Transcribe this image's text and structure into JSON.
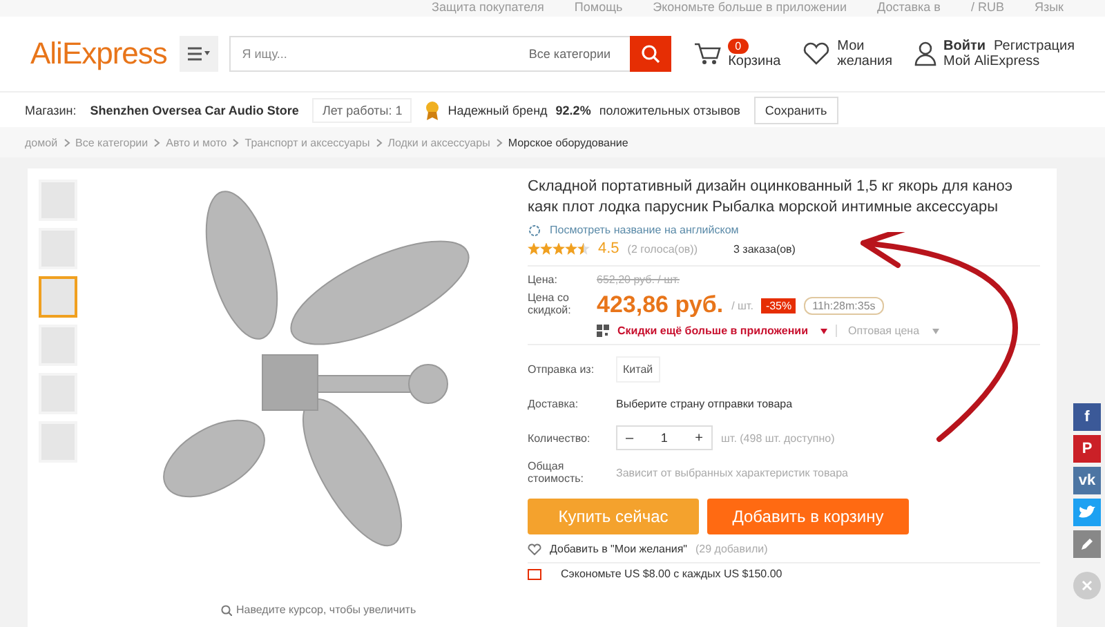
{
  "top_bar": {
    "links": [
      "Защита покупателя",
      "Помощь",
      "Экономьте больше в приложении",
      "Доставка в",
      "/ RUB",
      "Язык"
    ]
  },
  "header": {
    "logo": "AliExpress",
    "search": {
      "placeholder": "Я ищу...",
      "category": "Все категории"
    },
    "cart": {
      "count": "0",
      "label": "Корзина"
    },
    "wishlist": {
      "line1": "Мои",
      "line2": "желания"
    },
    "account": {
      "login": "Войти",
      "register": "Регистрация",
      "my": "Мой AliExpress"
    }
  },
  "store_bar": {
    "label": "Магазин:",
    "name": "Shenzhen Oversea Car Audio Store",
    "years": "Лет работы: 1",
    "brand": "Надежный бренд",
    "percent": "92.2%",
    "feedback": "положительных отзывов",
    "save": "Сохранить"
  },
  "breadcrumbs": [
    "домой",
    "Все категории",
    "Авто и мото",
    "Транспорт и аксессуары",
    "Лодки и аксессуары",
    "Морское оборудование"
  ],
  "gallery": {
    "thumbnails": [
      {
        "selected": false
      },
      {
        "selected": false
      },
      {
        "selected": true
      },
      {
        "selected": false
      },
      {
        "selected": false
      },
      {
        "selected": false
      }
    ],
    "zoom_hint": "Наведите курсор, чтобы увеличить"
  },
  "product": {
    "title": "Складной портативный дизайн оцинкованный 1,5 кг якорь для каноэ каяк плот лодка парусник Рыбалка морской интимные аксессуары",
    "translate_link": "Посмотреть название на английском",
    "stars": 4.5,
    "rating": "4.5",
    "votes": "(2 голоса(ов))",
    "orders": "3 заказа(ов)",
    "price_label": "Цена:",
    "old_price": "652,20 руб. / шт.",
    "discount_label": "Цена со скидкой:",
    "price": "423,86 руб.",
    "unit": "/ шт.",
    "discount": "-35%",
    "timer": "11h:28m:35s",
    "app_deal": "Скидки ещё больше в приложении",
    "wholesale": "Оптовая цена",
    "ship_from_label": "Отправка из:",
    "ship_from": "Китай",
    "delivery_label": "Доставка:",
    "delivery": "Выберите страну отправки товара",
    "qty_label": "Количество:",
    "qty_minus": "–",
    "qty": "1",
    "qty_plus": "+",
    "qty_note": "шт. (498 шт. доступно)",
    "total_label": "Общая стоимость:",
    "total": "Зависит от выбранных характеристик товара",
    "buy": "Купить сейчас",
    "add_cart": "Добавить в корзину",
    "wish": "Добавить в \"Мои желания\"",
    "wish_count": "(29 добавили)",
    "coupon": "Сэкономьте US $8.00 с каждых US $150.00"
  },
  "share": [
    {
      "kind": "facebook",
      "label": "f"
    },
    {
      "kind": "pinterest",
      "label": "P"
    },
    {
      "kind": "vk",
      "label": "vk"
    },
    {
      "kind": "twitter"
    },
    {
      "kind": "edit"
    },
    {
      "kind": "close"
    }
  ]
}
